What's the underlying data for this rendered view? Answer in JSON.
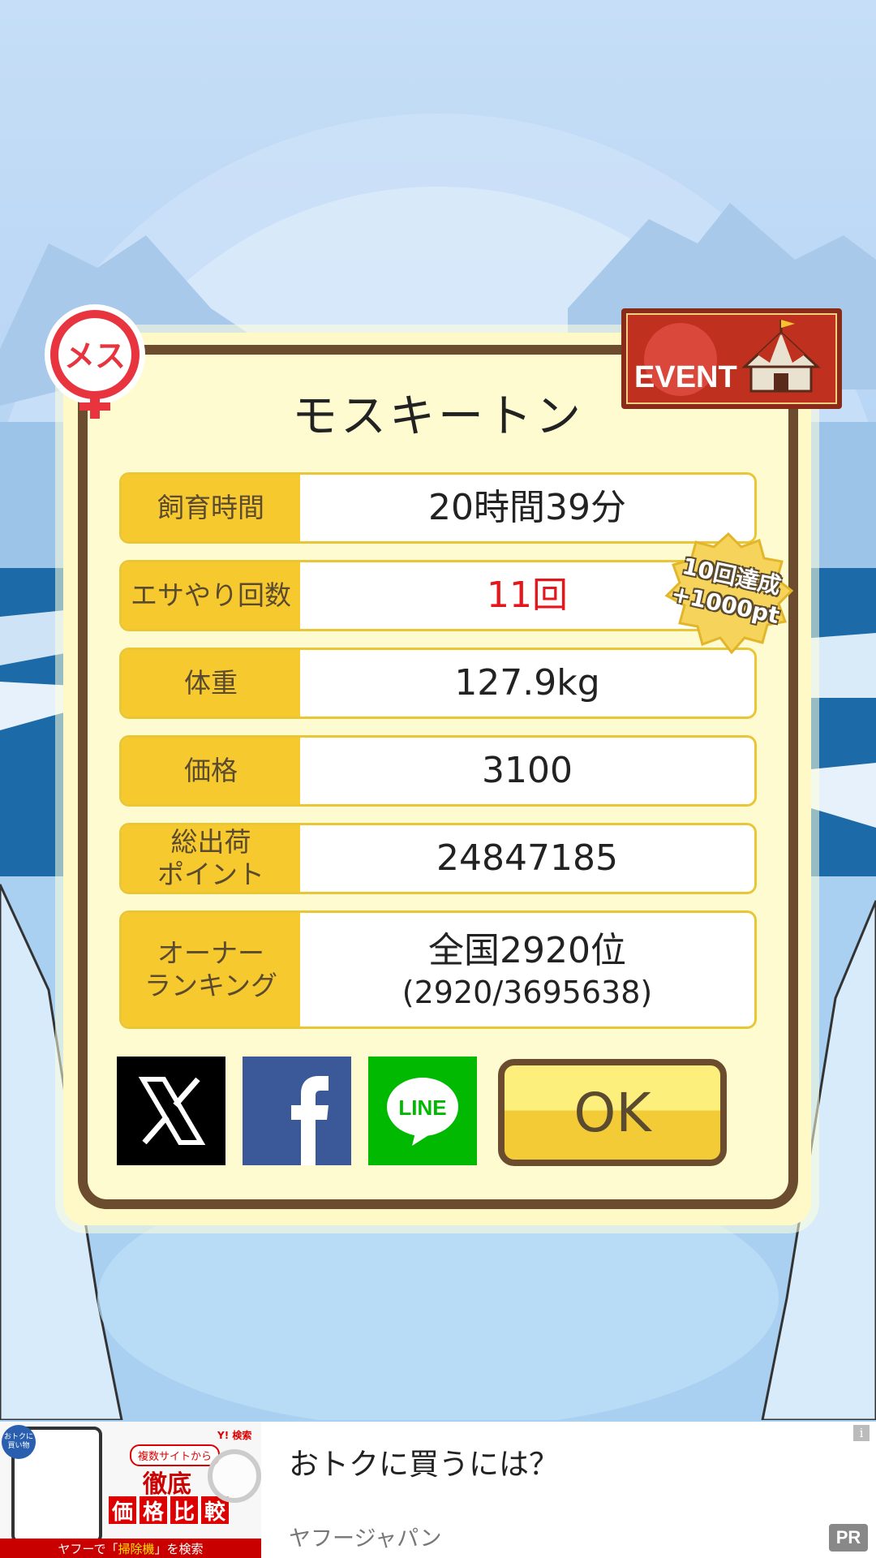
{
  "pet": {
    "name": "モスキートン",
    "gender_label": "メス",
    "event_label": "EVENT"
  },
  "stats": [
    {
      "label": "飼育時間",
      "value": "20時間39分"
    },
    {
      "label": "エサやり回数",
      "value": "11回",
      "highlight": "#e5161c"
    },
    {
      "label": "体重",
      "value": "127.9kg"
    },
    {
      "label": "価格",
      "value": "3100"
    },
    {
      "label_line1": "総出荷",
      "label_line2": "ポイント",
      "value": "24847185"
    },
    {
      "label_line1": "オーナー",
      "label_line2": "ランキング",
      "value": "全国2920位",
      "value_sub": "(2920/3695638)"
    }
  ],
  "achievement_badge": {
    "line1": "10回達成",
    "line2": "+1000pt"
  },
  "share": {
    "line_label": "LINE"
  },
  "ok_button": "OK",
  "ad": {
    "title": "おトクに買うには？",
    "source": "ヤフージャパン",
    "pr": "PR",
    "info": "i",
    "image": {
      "corner_tag_line1": "おトクに",
      "corner_tag_line2": "買い物",
      "pill": "複数サイトから",
      "headline": "徹底",
      "chars": [
        "価",
        "格",
        "比",
        "較"
      ],
      "footer_prefix": "ヤフーで「",
      "footer_keyword": "掃除機",
      "footer_suffix": "」を検索",
      "logo": "Y! 検索"
    }
  },
  "colors": {
    "accent_yellow": "#f6c92f",
    "frame_brown": "#6b4c2e",
    "card_bg": "#fffbd0",
    "event_red": "#c0301e",
    "gender_red": "#e8343e"
  }
}
